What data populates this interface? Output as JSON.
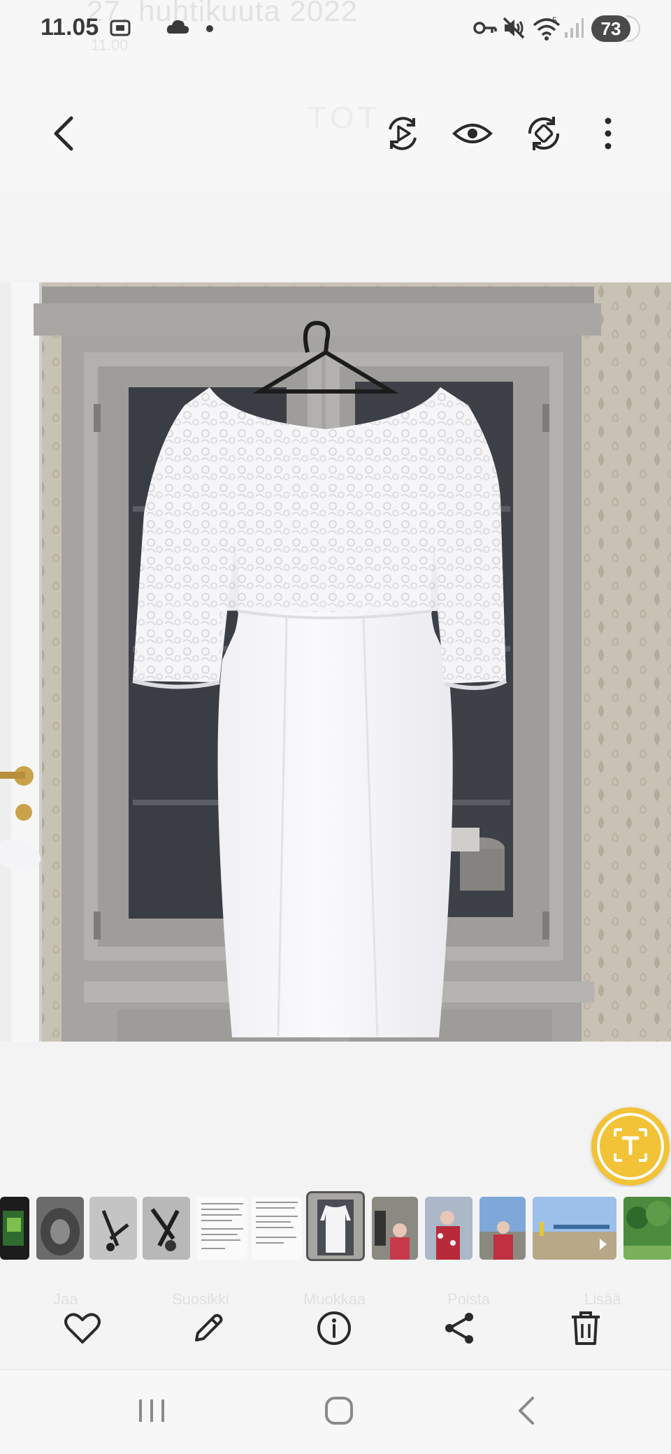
{
  "status_bar": {
    "time": "11.05",
    "battery": "73",
    "wifi_level": "5",
    "icons": [
      "screenshot-icon",
      "cloud-sync-icon",
      "dot-icon",
      "vpn-key-icon",
      "mute-icon",
      "wifi-icon",
      "signal-icon"
    ]
  },
  "background_overlay": {
    "date_text": "27. huhtikuuta 2022",
    "time_text": "11.00",
    "title_text": "TOT"
  },
  "top_toolbar": {
    "back": "back-arrow-icon",
    "buttons": [
      "remaster-play-icon",
      "eye-icon",
      "rotate-icon",
      "more-vert-icon"
    ]
  },
  "viewer": {
    "image": "photo of white lace dress on hanger in front of grey cabinet",
    "overlay_button": "text-extract-icon"
  },
  "filmstrip": {
    "selected_index": 6,
    "count": 12
  },
  "action_bar": {
    "buttons": [
      "heart-icon",
      "pencil-icon",
      "info-icon",
      "share-icon",
      "trash-icon"
    ],
    "ghost_labels": [
      "Jaa",
      "Suosikki",
      "Muokkaa",
      "Poista",
      "Lisää"
    ]
  },
  "nav_bar": {
    "buttons": [
      "recent-apps-icon",
      "home-icon",
      "back-icon"
    ]
  },
  "colors": {
    "accent_yellow": "#f2c237",
    "icon_dark": "#2a2a2a",
    "background": "#f3f3f3"
  }
}
